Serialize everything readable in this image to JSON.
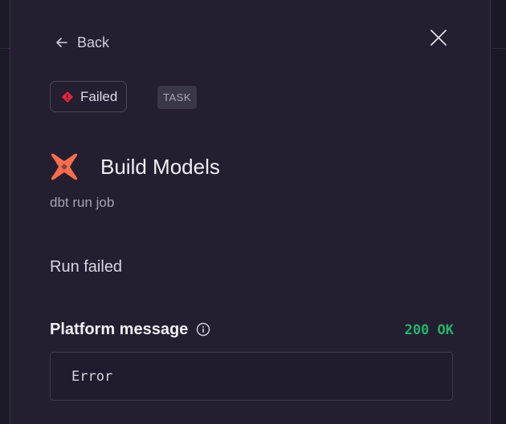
{
  "nav": {
    "back_label": "Back",
    "back_icon": "arrow-left-icon",
    "close_icon": "close-icon"
  },
  "status": {
    "label": "Failed",
    "icon": "error-diamond-icon",
    "color": "#e5243b"
  },
  "type_tag": "TASK",
  "job": {
    "title": "Build Models",
    "subtitle": "dbt run job",
    "logo_icon": "dbt-logo-icon",
    "logo_color": "#fe6d4c"
  },
  "result": {
    "heading": "Run failed"
  },
  "platform_message": {
    "label": "Platform message",
    "info_icon": "info-icon",
    "status_code": "200 OK",
    "status_color": "#22b36b",
    "message": "Error"
  }
}
